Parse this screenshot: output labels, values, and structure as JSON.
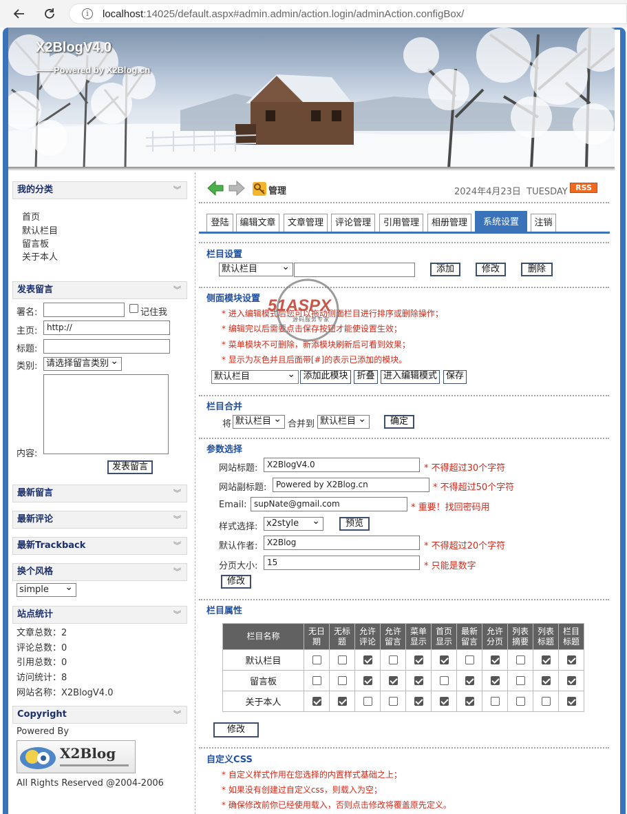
{
  "browser": {
    "url_host": "localhost",
    "url_rest": ":14025/default.aspx#admin.admin/action.login/adminAction.configBox/"
  },
  "banner": {
    "title": "X2BlogV4.0",
    "subtitle": "——Powered by X2Blog.cn"
  },
  "sidebar": {
    "categories": {
      "title": "我的分类",
      "items": [
        "首页",
        "默认栏目",
        "留言板",
        "关于本人"
      ]
    },
    "post_message": {
      "title": "发表留言",
      "name_label": "署名:",
      "remember_label": "记住我",
      "homepage_label": "主页:",
      "homepage_value": "http://",
      "subject_label": "标题:",
      "category_label": "类别:",
      "category_value": "请选择留言类别",
      "content_label": "内容:",
      "submit_label": "发表留言"
    },
    "latest_messages": "最新留言",
    "latest_comments": "最新评论",
    "latest_trackback": "最新Trackback",
    "style": {
      "title": "换个风格",
      "value": "simple"
    },
    "stats": {
      "title": "站点统计",
      "lines": [
        "文章总数：2",
        "评论总数：0",
        "引用总数：0",
        "访问统计：8",
        "网站名称：X2BlogV4.0"
      ]
    },
    "copyright": {
      "title": "Copyright",
      "powered": "Powered By",
      "logo_text": "X2Blog",
      "rights": "All Rights Reserved @2004-2006"
    },
    "collapse_glyph": "»"
  },
  "main": {
    "header": {
      "manage_label": "管理",
      "date": "2024年4月23日",
      "weekday": "TUESDAY",
      "rss": "RSS"
    },
    "tabs": [
      "登陆",
      "编辑文章",
      "文章管理",
      "评论管理",
      "引用管理",
      "相册管理",
      "系统设置",
      "注销"
    ],
    "column_settings": {
      "title": "栏目设置",
      "select_value": "默认栏目",
      "add": "添加",
      "edit": "修改",
      "delete": "删除"
    },
    "side_module": {
      "title": "侧面模块设置",
      "notes": [
        "* 进入编辑模式后您可以拖动侧面栏目进行排序或删除操作；",
        "* 编辑完以后需要点击保存按钮才能使设置生效；",
        "* 菜单模块不可删除，新添模块刷新后可看到效果；",
        "* 显示为灰色并且后面带[#]的表示已添加的模块。"
      ],
      "select_value": "默认栏目",
      "add_module": "添加此模块",
      "fold": "折叠",
      "edit_mode": "进入编辑模式",
      "save": "保存"
    },
    "merge": {
      "title": "栏目合并",
      "prefix": "将",
      "from": "默认栏目",
      "middle": "合并到",
      "to": "默认栏目",
      "confirm": "确定"
    },
    "params": {
      "title": "参数选择",
      "site_title_label": "网站标题:",
      "site_title": "X2BlogV4.0",
      "site_title_note": "* 不得超过30个字符",
      "subtitle_label": "网站副标题:",
      "subtitle": "Powered by X2Blog.cn",
      "subtitle_note": "* 不得超过50个字符",
      "email_label": "Email:",
      "email": "supNate@gmail.com",
      "email_note": "* 重要！找回密码用",
      "style_label": "样式选择:",
      "style": "x2style",
      "preview": "预览",
      "author_label": "默认作者:",
      "author": "X2Blog",
      "author_note": "* 不得超过20个字符",
      "page_label": "分页大小:",
      "page_size": "15",
      "page_note": "* 只能是数字",
      "submit": "修改"
    },
    "column_props": {
      "title": "栏目属性",
      "name_header": "栏目名称",
      "headers": [
        [
          "无日",
          "期"
        ],
        [
          "无标",
          "题"
        ],
        [
          "允许",
          "评论"
        ],
        [
          "允许",
          "留言"
        ],
        [
          "菜单",
          "显示"
        ],
        [
          "首页",
          "显示"
        ],
        [
          "最新",
          "留言"
        ],
        [
          "允许",
          "分页"
        ],
        [
          "列表",
          "摘要"
        ],
        [
          "列表",
          "标题"
        ],
        [
          "栏目",
          "标题"
        ]
      ],
      "rows": [
        {
          "name": "默认栏目",
          "checks": [
            false,
            false,
            true,
            false,
            true,
            true,
            false,
            true,
            false,
            true,
            true
          ]
        },
        {
          "name": "留言板",
          "checks": [
            false,
            false,
            true,
            true,
            true,
            false,
            true,
            true,
            false,
            true,
            true
          ]
        },
        {
          "name": "关于本人",
          "checks": [
            true,
            true,
            false,
            false,
            true,
            true,
            true,
            false,
            false,
            false,
            true
          ]
        }
      ],
      "submit": "修改"
    },
    "custom_css": {
      "title": "自定义CSS",
      "notes": [
        "* 自定义样式作用在您选择的内置样式基础之上；",
        "* 如果没有创建过自定义css，则载入为空；",
        "* 确保修改前你已经使用载入，否则点击修改将覆盖原先定义。"
      ]
    }
  },
  "watermark": {
    "brand": "51ASPX",
    "tagline": "源码服务专家"
  },
  "colors": {
    "frame": "#3a73b9",
    "section_title": "#2050a0",
    "note_red": "#d12a1a",
    "table_header": "#616161"
  }
}
